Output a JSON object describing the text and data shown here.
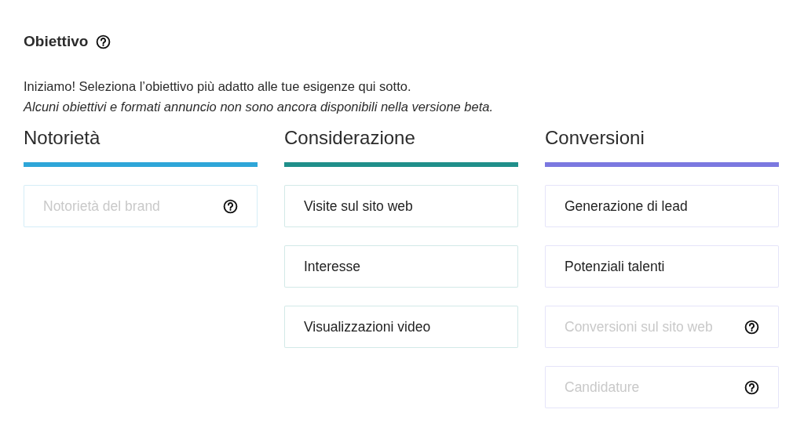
{
  "section": {
    "title": "Obiettivo",
    "intro": "Iniziamo! Seleziona l’obiettivo più adatto alle tue esigenze qui sotto.",
    "note": "Alcuni obiettivi e formati annuncio non sono ancora disponibili nella versione beta."
  },
  "columns": [
    {
      "title": "Notorietà",
      "color": "#2ea6d8",
      "objectives": [
        {
          "label": "Notorietà del brand",
          "disabled": true
        }
      ]
    },
    {
      "title": "Considerazione",
      "color": "#1f8f8a",
      "objectives": [
        {
          "label": "Visite sul sito web",
          "disabled": false
        },
        {
          "label": "Interesse",
          "disabled": false
        },
        {
          "label": "Visualizzazioni video",
          "disabled": false
        }
      ]
    },
    {
      "title": "Conversioni",
      "color": "#7b78e0",
      "objectives": [
        {
          "label": "Generazione di lead",
          "disabled": false
        },
        {
          "label": "Potenziali talenti",
          "disabled": false
        },
        {
          "label": "Conversioni sul sito web",
          "disabled": true
        },
        {
          "label": "Candidature",
          "disabled": true
        }
      ]
    }
  ]
}
